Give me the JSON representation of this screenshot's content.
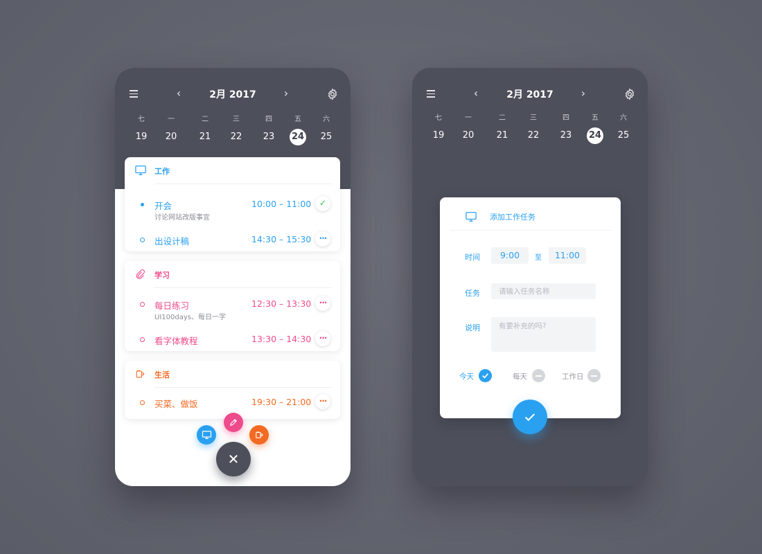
{
  "colors": {
    "work": "#2aa0f0",
    "study": "#ee4b8b",
    "life": "#f26a24",
    "header_bg": "#4d4f5b",
    "close_fab": "#4d4f5b",
    "check_green": "#33c24a"
  },
  "calendar": {
    "month_title": "2月 2017",
    "prev_icon": "chevron-left-icon",
    "next_icon": "chevron-right-icon",
    "weekday_names": [
      "七",
      "一",
      "二",
      "三",
      "四",
      "五",
      "六"
    ],
    "dates": [
      "19",
      "20",
      "21",
      "22",
      "23",
      "24",
      "25"
    ],
    "selected_index": 5
  },
  "left_screen": {
    "categories": [
      {
        "key": "work",
        "label": "工作",
        "icon": "monitor-icon",
        "tasks": [
          {
            "name": "开会",
            "subtitle": "讨论网站改版事宜",
            "time": "10:00 – 11:00",
            "action": "✓",
            "done": true
          },
          {
            "name": "出设计稿",
            "subtitle": "",
            "time": "14:30 – 15:30",
            "action": "···",
            "done": false
          }
        ]
      },
      {
        "key": "study",
        "label": "学习",
        "icon": "paperclip-icon",
        "tasks": [
          {
            "name": "每日练习",
            "subtitle": "UI100days、每日一字",
            "time": "12:30 – 13:30",
            "action": "···",
            "done": false
          },
          {
            "name": "看字体教程",
            "subtitle": "",
            "time": "13:30 – 14:30",
            "action": "···",
            "done": false
          }
        ]
      },
      {
        "key": "life",
        "label": "生活",
        "icon": "coffee-cup-icon",
        "tasks": [
          {
            "name": "买菜、做饭",
            "subtitle": "",
            "time": "19:30 – 21:00",
            "action": "···",
            "done": false
          }
        ]
      }
    ],
    "fab_menu": {
      "work_icon": "monitor-icon",
      "study_icon": "pencil-icon",
      "life_icon": "coffee-cup-icon",
      "close_icon": "close-icon",
      "close_glyph": "✕"
    }
  },
  "right_screen": {
    "dialog": {
      "title": "添加工作任务",
      "icon": "monitor-icon",
      "time_label": "时间",
      "start_time": "9:00",
      "to_label": "至",
      "end_time": "11:00",
      "task_label": "任务",
      "task_placeholder": "请输入任务名称",
      "note_label": "说明",
      "note_placeholder": "有要补充的吗?",
      "options": [
        {
          "label": "今天",
          "checked": true
        },
        {
          "label": "每天",
          "checked": false
        },
        {
          "label": "工作日",
          "checked": false
        }
      ],
      "confirm_icon": "check-icon"
    }
  }
}
